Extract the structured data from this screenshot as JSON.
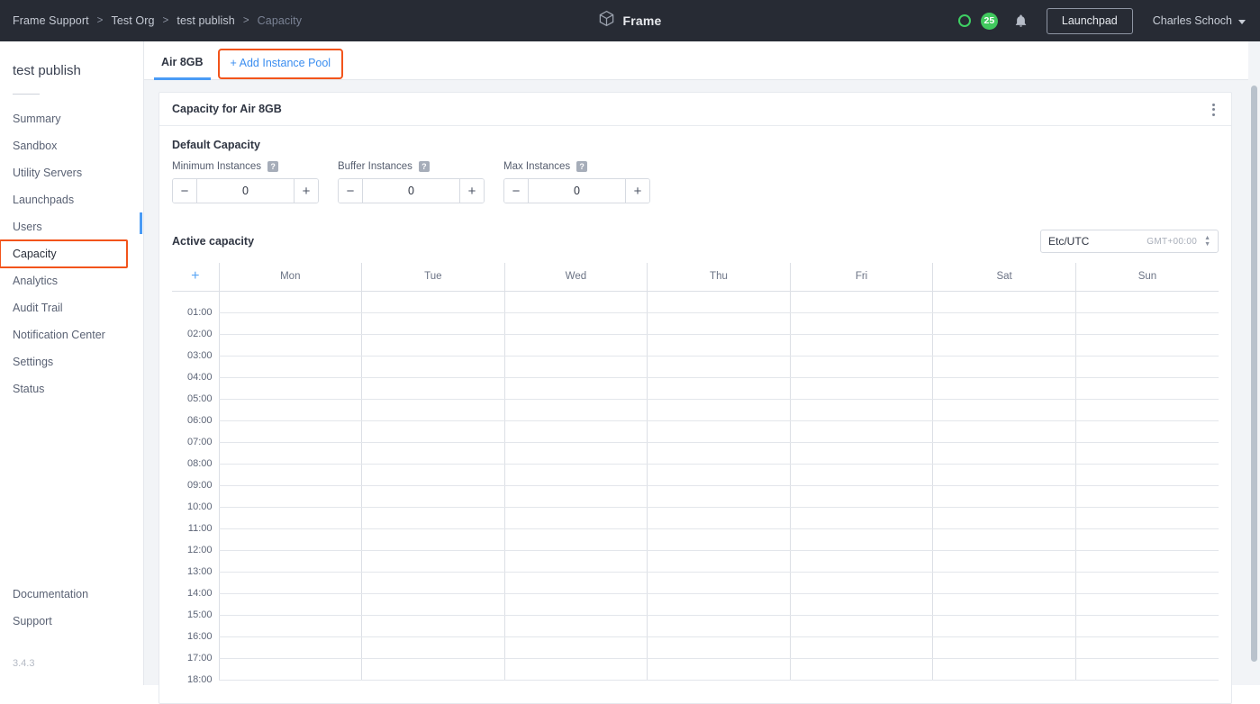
{
  "topbar": {
    "breadcrumb": [
      "Frame Support",
      "Test Org",
      "test publish",
      "Capacity"
    ],
    "separator": ">",
    "brand": "Frame",
    "brand_icon": "cube-icon",
    "status_icon": "status-ring-icon",
    "notification_count": "25",
    "bell_icon": "bell-icon",
    "launchpad_label": "Launchpad",
    "user_name": "Charles Schoch",
    "user_caret_icon": "chevron-down-icon",
    "bg_color": "#272b34"
  },
  "sidebar": {
    "title": "test publish",
    "items": [
      {
        "label": "Summary"
      },
      {
        "label": "Sandbox"
      },
      {
        "label": "Utility Servers"
      },
      {
        "label": "Launchpads"
      },
      {
        "label": "Users"
      },
      {
        "label": "Capacity"
      },
      {
        "label": "Analytics"
      },
      {
        "label": "Audit Trail"
      },
      {
        "label": "Notification Center"
      },
      {
        "label": "Settings"
      },
      {
        "label": "Status"
      }
    ],
    "footer_items": [
      {
        "label": "Documentation"
      },
      {
        "label": "Support"
      }
    ],
    "version": "3.4.3",
    "active_item": "Capacity",
    "highlight_color": "#f2541b",
    "active_indicator_color": "#4a9bf5"
  },
  "tabs": {
    "items": [
      {
        "label": "Air 8GB",
        "active": true
      }
    ],
    "add_pool_label": "+ Add Instance Pool",
    "add_pool_color": "#3b8ef0",
    "highlight_color": "#f2541b"
  },
  "card": {
    "title": "Capacity for Air 8GB",
    "menu_icon": "kebab-menu-icon"
  },
  "default_capacity": {
    "section_title": "Default Capacity",
    "fields": [
      {
        "label": "Minimum Instances",
        "value": "0",
        "help_icon": "help-icon",
        "minus": "−",
        "plus": "+"
      },
      {
        "label": "Buffer Instances",
        "value": "0",
        "help_icon": "help-icon",
        "minus": "−",
        "plus": "+"
      },
      {
        "label": "Max Instances",
        "value": "0",
        "help_icon": "help-icon",
        "minus": "−",
        "plus": "+"
      }
    ]
  },
  "active_capacity": {
    "section_title": "Active capacity",
    "timezone": {
      "name": "Etc/UTC",
      "offset": "GMT+00:00",
      "arrows_icon": "sort-arrows-icon"
    },
    "add_column_icon": "plus-icon",
    "days": [
      "Mon",
      "Tue",
      "Wed",
      "Thu",
      "Fri",
      "Sat",
      "Sun"
    ],
    "times": [
      "01:00",
      "02:00",
      "03:00",
      "04:00",
      "05:00",
      "06:00",
      "07:00",
      "08:00",
      "09:00",
      "10:00",
      "11:00",
      "12:00",
      "13:00",
      "14:00",
      "15:00",
      "16:00",
      "17:00",
      "18:00"
    ]
  },
  "scrollbar": {
    "name": "vertical-scrollbar"
  }
}
